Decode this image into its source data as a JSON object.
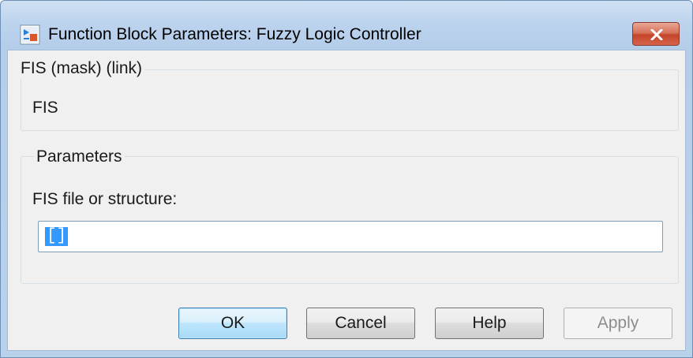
{
  "window": {
    "title": "Function Block Parameters: Fuzzy Logic Controller",
    "icon": "simulink-block-icon",
    "close_icon": "close-icon"
  },
  "description_group": {
    "title": "FIS (mask) (link)",
    "text": "FIS"
  },
  "parameters_group": {
    "title": "Parameters",
    "field_label": "FIS file or structure:",
    "field_value": "[]"
  },
  "buttons": {
    "ok": "OK",
    "cancel": "Cancel",
    "help": "Help",
    "apply": "Apply"
  },
  "colors": {
    "accent": "#3399ff",
    "close_button": "#c4452a",
    "disabled_text": "#8d8d8d"
  }
}
